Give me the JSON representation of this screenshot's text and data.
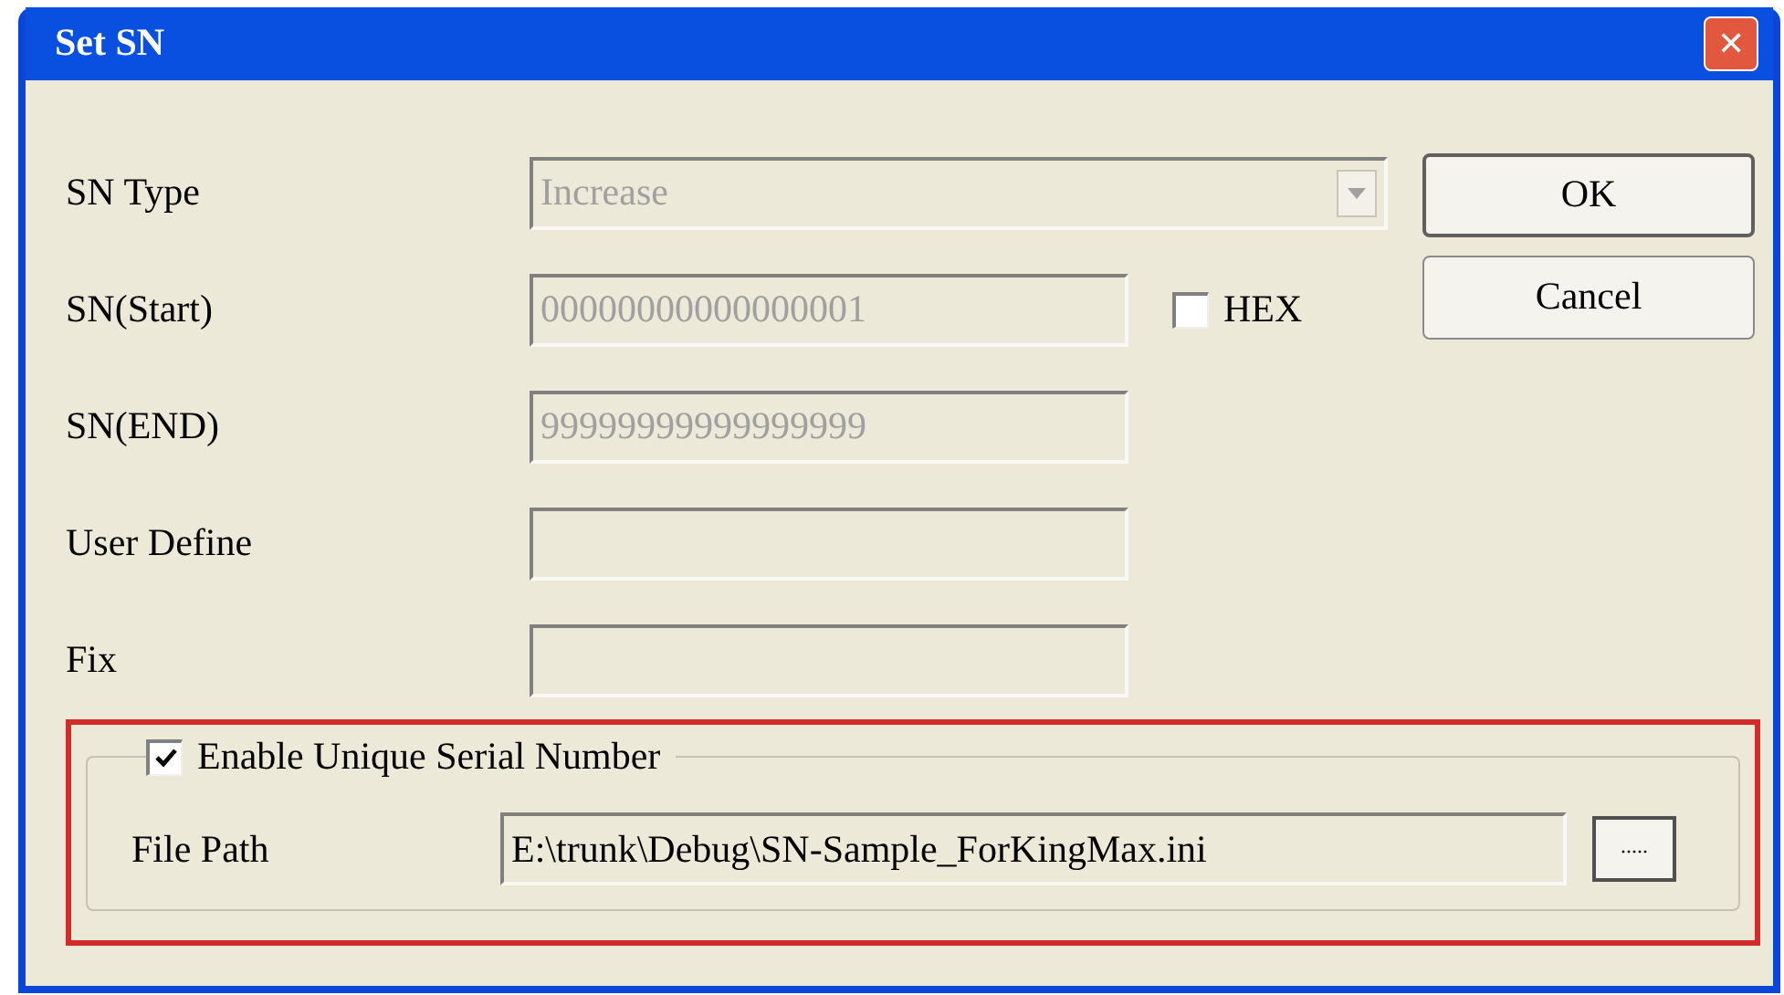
{
  "window": {
    "title": "Set SN",
    "close": "✕"
  },
  "fields": [
    {
      "label": "SN Type",
      "kind": "combo",
      "value": "Increase",
      "disabled": true
    },
    {
      "label": "SN(Start)",
      "kind": "text",
      "value": "00000000000000001",
      "disabled": true
    },
    {
      "label": "SN(END)",
      "kind": "text",
      "value": "99999999999999999",
      "disabled": true
    },
    {
      "label": "User Define",
      "kind": "text",
      "disabled": true
    },
    {
      "label": "Fix",
      "kind": "text",
      "disabled": true
    }
  ],
  "hex": {
    "label": "HEX",
    "checked": false
  },
  "buttons": [
    {
      "label": "OK",
      "default": true
    },
    {
      "label": "Cancel",
      "default": false
    }
  ],
  "unique": {
    "label": "Enable Unique Serial Number",
    "checked": true,
    "highlighted": true,
    "file_path_label": "File Path",
    "file_path": "E:\\trunk\\Debug\\SN-Sample_ForKingMax.ini",
    "browse": "....."
  }
}
